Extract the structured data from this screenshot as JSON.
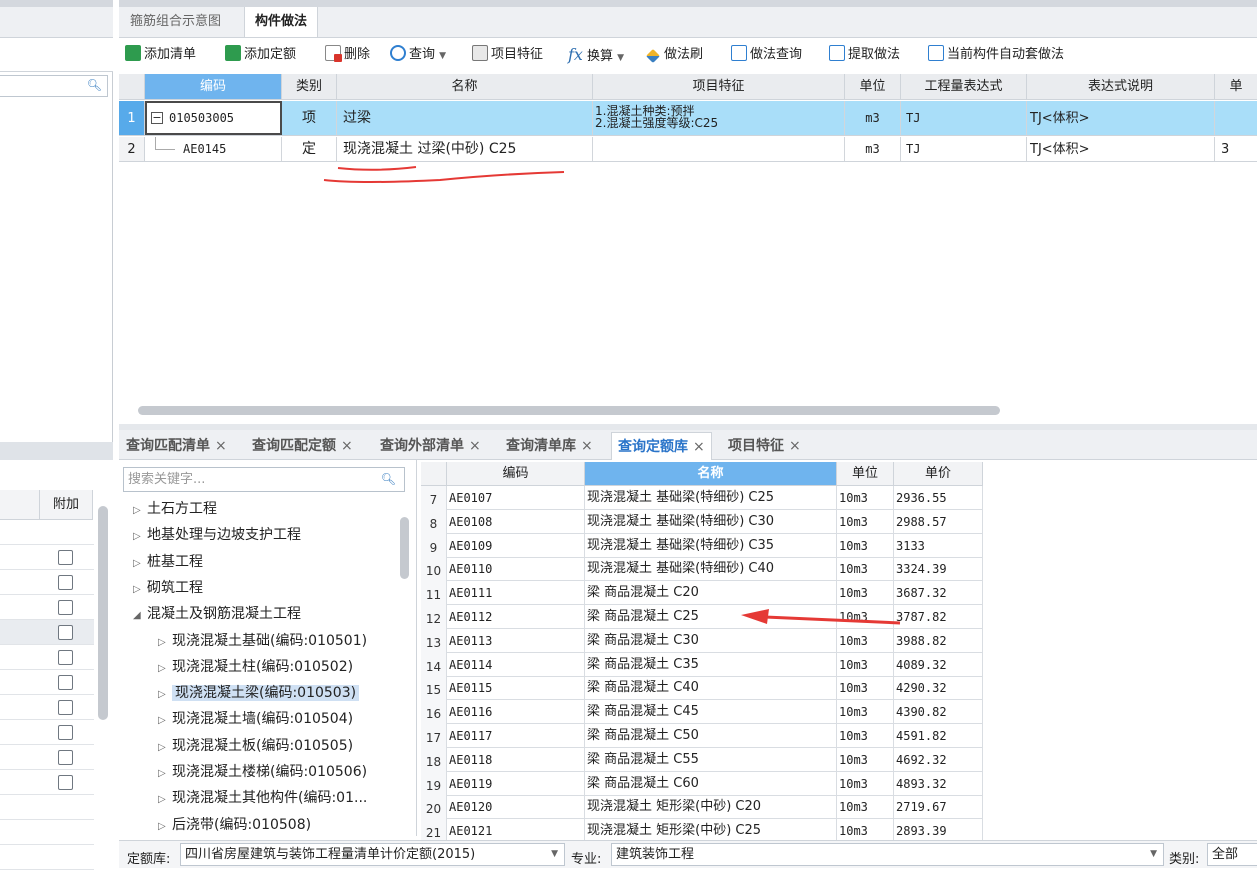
{
  "top_tabs": [
    {
      "label": "箍筋组合示意图",
      "active": false
    },
    {
      "label": "构件做法",
      "active": true
    }
  ],
  "toolbar": {
    "add_list": "添加清单",
    "add_quota": "添加定额",
    "delete": "删除",
    "query": "查询",
    "item_features": "项目特征",
    "convert": "换算",
    "brush": "做法刷",
    "method_query": "做法查询",
    "extract": "提取做法",
    "auto_apply": "当前构件自动套做法"
  },
  "main_grid": {
    "headers": [
      "编码",
      "类别",
      "名称",
      "项目特征",
      "单位",
      "工程量表达式",
      "表达式说明",
      "单"
    ],
    "rows": [
      {
        "num": "1",
        "code": "010503005",
        "type": "项",
        "name": "过梁",
        "feature1": "1.混凝土种类:预拌",
        "feature2": "2.混凝土强度等级:C25",
        "unit": "m3",
        "expr": "TJ",
        "desc": "TJ<体积>",
        "extra": ""
      },
      {
        "num": "2",
        "code": "AE0145",
        "type": "定",
        "name": "现浇混凝土 过梁(中砂) C25",
        "feature1": "",
        "feature2": "",
        "unit": "m3",
        "expr": "TJ",
        "desc": "TJ<体积>",
        "extra": "3"
      }
    ]
  },
  "bottom_tabs": [
    "查询匹配清单",
    "查询匹配定额",
    "查询外部清单",
    "查询清单库",
    "查询定额库",
    "项目特征"
  ],
  "tree": {
    "search_placeholder": "搜索关键字...",
    "nodes": [
      {
        "label": "土石方工程",
        "level": 0,
        "expanded": false
      },
      {
        "label": "地基处理与边坡支护工程",
        "level": 0,
        "expanded": false
      },
      {
        "label": "桩基工程",
        "level": 0,
        "expanded": false
      },
      {
        "label": "砌筑工程",
        "level": 0,
        "expanded": false
      },
      {
        "label": "混凝土及钢筋混凝土工程",
        "level": 0,
        "expanded": true
      },
      {
        "label": "现浇混凝土基础(编码:010501)",
        "level": 1,
        "expanded": false
      },
      {
        "label": "现浇混凝土柱(编码:010502)",
        "level": 1,
        "expanded": false
      },
      {
        "label": "现浇混凝土梁(编码:010503)",
        "level": 1,
        "expanded": false,
        "selected": true
      },
      {
        "label": "现浇混凝土墙(编码:010504)",
        "level": 1,
        "expanded": false
      },
      {
        "label": "现浇混凝土板(编码:010505)",
        "level": 1,
        "expanded": false
      },
      {
        "label": "现浇混凝土楼梯(编码:010506)",
        "level": 1,
        "expanded": false
      },
      {
        "label": "现浇混凝土其他构件(编码:01...",
        "level": 1,
        "expanded": false
      },
      {
        "label": "后浇带(编码:010508)",
        "level": 1,
        "expanded": false
      }
    ]
  },
  "quota_table": {
    "headers": [
      "编码",
      "名称",
      "单位",
      "单价"
    ],
    "rows": [
      {
        "n": "7",
        "code": "AE0107",
        "name": "现浇混凝土 基础梁(特细砂) C25",
        "unit": "10m3",
        "price": "2936.55"
      },
      {
        "n": "8",
        "code": "AE0108",
        "name": "现浇混凝土 基础梁(特细砂) C30",
        "unit": "10m3",
        "price": "2988.57"
      },
      {
        "n": "9",
        "code": "AE0109",
        "name": "现浇混凝土 基础梁(特细砂) C35",
        "unit": "10m3",
        "price": "3133"
      },
      {
        "n": "10",
        "code": "AE0110",
        "name": "现浇混凝土 基础梁(特细砂) C40",
        "unit": "10m3",
        "price": "3324.39"
      },
      {
        "n": "11",
        "code": "AE0111",
        "name": "梁 商品混凝土 C20",
        "unit": "10m3",
        "price": "3687.32"
      },
      {
        "n": "12",
        "code": "AE0112",
        "name": "梁 商品混凝土 C25",
        "unit": "10m3",
        "price": "3787.82"
      },
      {
        "n": "13",
        "code": "AE0113",
        "name": "梁 商品混凝土 C30",
        "unit": "10m3",
        "price": "3988.82"
      },
      {
        "n": "14",
        "code": "AE0114",
        "name": "梁 商品混凝土 C35",
        "unit": "10m3",
        "price": "4089.32"
      },
      {
        "n": "15",
        "code": "AE0115",
        "name": "梁 商品混凝土 C40",
        "unit": "10m3",
        "price": "4290.32"
      },
      {
        "n": "16",
        "code": "AE0116",
        "name": "梁 商品混凝土 C45",
        "unit": "10m3",
        "price": "4390.82"
      },
      {
        "n": "17",
        "code": "AE0117",
        "name": "梁 商品混凝土 C50",
        "unit": "10m3",
        "price": "4591.82"
      },
      {
        "n": "18",
        "code": "AE0118",
        "name": "梁 商品混凝土 C55",
        "unit": "10m3",
        "price": "4692.32"
      },
      {
        "n": "19",
        "code": "AE0119",
        "name": "梁 商品混凝土 C60",
        "unit": "10m3",
        "price": "4893.32"
      },
      {
        "n": "20",
        "code": "AE0120",
        "name": "现浇混凝土 矩形梁(中砂) C20",
        "unit": "10m3",
        "price": "2719.67"
      },
      {
        "n": "21",
        "code": "AE0121",
        "name": "现浇混凝土 矩形梁(中砂) C25",
        "unit": "10m3",
        "price": "2893.39"
      }
    ]
  },
  "left_panel": {
    "col_header": "附加"
  },
  "status_bar": {
    "quota_lib_label": "定额库:",
    "quota_lib_value": "四川省房屋建筑与装饰工程量清单计价定额(2015)",
    "major_label": "专业:",
    "major_value": "建筑装饰工程",
    "category_label": "类别:",
    "category_value": "全部"
  },
  "colors": {
    "accent": "#6fb4ee",
    "selected_row": "#a9def9",
    "annotation": "#e53935",
    "active_tab_text": "#2a74c9"
  }
}
